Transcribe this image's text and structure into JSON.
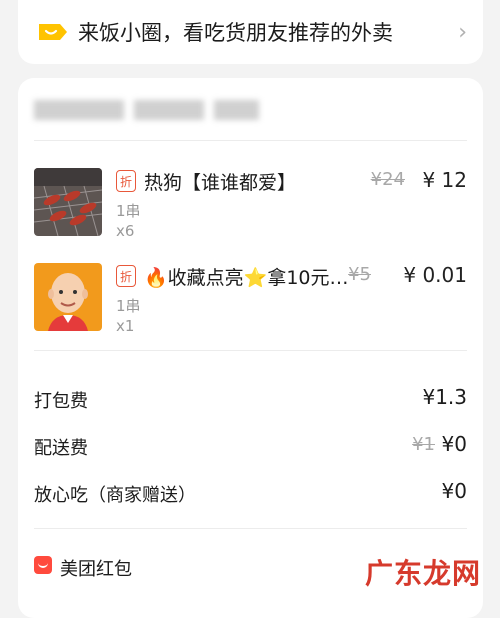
{
  "banner": {
    "text": "来饭小圈，看吃货朋友推荐的外卖",
    "chevron": "›"
  },
  "items": [
    {
      "name": "热狗【谁谁都爱】",
      "tag": "折",
      "spec": "1串",
      "qty": "x6",
      "old_price": "¥24",
      "price": "¥ 12"
    },
    {
      "name": "🔥收藏点亮⭐拿10元…",
      "tag": "折",
      "spec": "1串",
      "qty": "x1",
      "old_price": "¥5",
      "price": "¥ 0.01"
    }
  ],
  "fees": [
    {
      "label": "打包费",
      "value": "¥1.3",
      "old": ""
    },
    {
      "label": "配送费",
      "value": "¥0",
      "old": "¥1"
    },
    {
      "label": "放心吃（商家赠送）",
      "value": "¥0",
      "old": ""
    }
  ],
  "redpack": {
    "label": "美团红包"
  },
  "watermark": "广东龙网"
}
